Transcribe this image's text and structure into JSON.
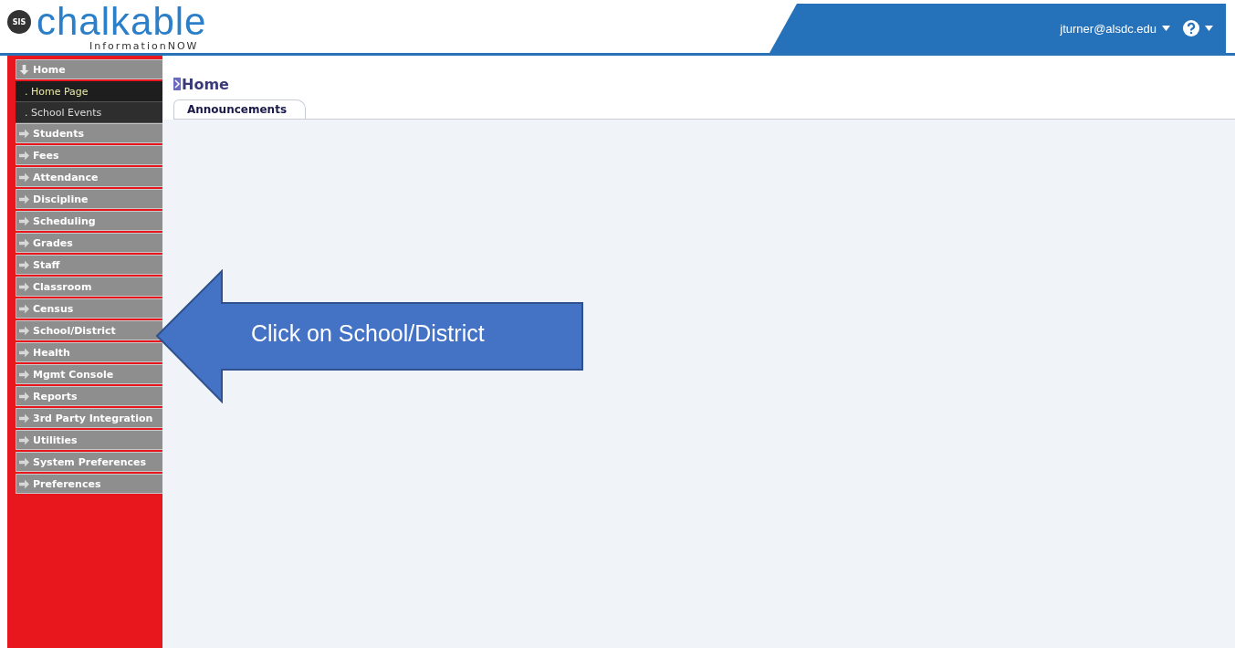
{
  "header": {
    "logo_badge": "SIS",
    "logo_text": "chalkable",
    "logo_subtext": "InformationNOW",
    "user": "jturner@alsdc.edu"
  },
  "menu": [
    {
      "label": "Home",
      "expanded": true,
      "children": [
        {
          "label": ". Home Page",
          "selected": true
        },
        {
          "label": ". School Events",
          "selected": false
        }
      ]
    },
    {
      "label": "Students",
      "expanded": false
    },
    {
      "label": "Fees",
      "expanded": false
    },
    {
      "label": "Attendance",
      "expanded": false
    },
    {
      "label": "Discipline",
      "expanded": false
    },
    {
      "label": "Scheduling",
      "expanded": false
    },
    {
      "label": "Grades",
      "expanded": false
    },
    {
      "label": "Staff",
      "expanded": false
    },
    {
      "label": "Classroom",
      "expanded": false
    },
    {
      "label": "Census",
      "expanded": false
    },
    {
      "label": "School/District",
      "expanded": false
    },
    {
      "label": "Health",
      "expanded": false
    },
    {
      "label": "Mgmt Console",
      "expanded": false
    },
    {
      "label": "Reports",
      "expanded": false
    },
    {
      "label": "3rd Party Integration",
      "expanded": false
    },
    {
      "label": "Utilities",
      "expanded": false
    },
    {
      "label": "System Preferences",
      "expanded": false
    },
    {
      "label": "Preferences",
      "expanded": false
    }
  ],
  "page": {
    "title": "Home",
    "tabs": [
      {
        "label": "Announcements",
        "selected": true
      }
    ]
  },
  "callout": {
    "text": "Click on School/District"
  }
}
